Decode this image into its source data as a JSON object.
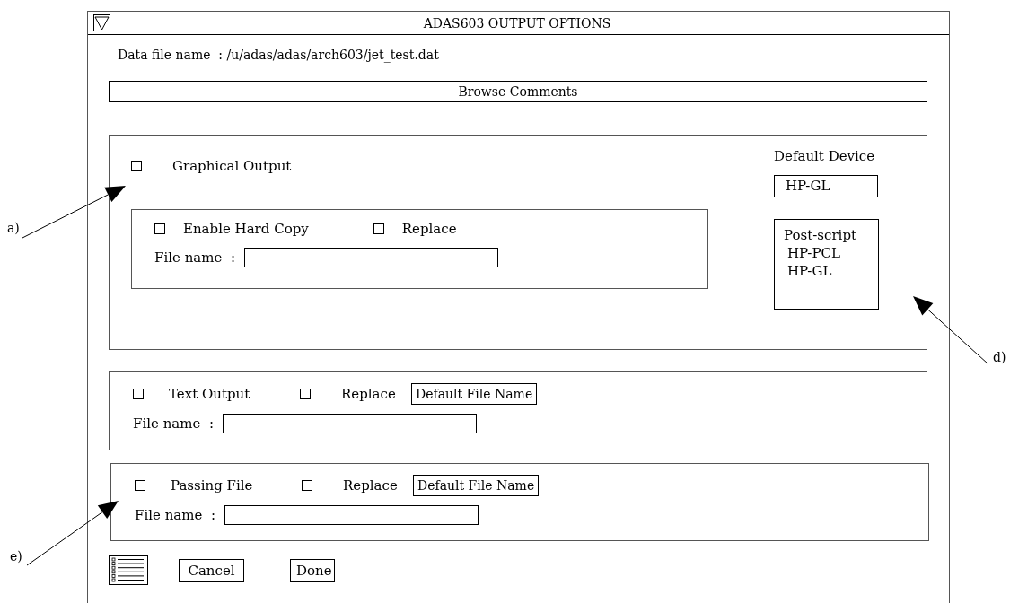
{
  "window": {
    "title": "ADAS603 OUTPUT OPTIONS"
  },
  "data_file": {
    "label": "Data file name  :",
    "value": "/u/adas/adas/arch603/jet_test.dat"
  },
  "browse_button": "Browse Comments",
  "graphical_output": {
    "label": "Graphical Output",
    "checked": false,
    "hard_copy": {
      "label": "Enable Hard Copy",
      "checked": false
    },
    "replace": {
      "label": "Replace",
      "checked": false
    },
    "file_name_label": "File name  :",
    "default_device_label": "Default Device",
    "default_device": "HP-GL",
    "devices": [
      {
        "label": "Post-script"
      },
      {
        "label": "HP-PCL"
      },
      {
        "label": "HP-GL"
      }
    ]
  },
  "text_output": {
    "label": "Text Output",
    "checked": false,
    "replace": {
      "label": "Replace",
      "checked": false
    },
    "default_button": "Default File Name",
    "file_name_label": "File name  :"
  },
  "passing_file": {
    "label": "Passing File",
    "checked": false,
    "replace": {
      "label": "Replace",
      "checked": false
    },
    "default_button": "Default File Name",
    "file_name_label": "File name  :"
  },
  "buttons": [
    "Cancel",
    "Done"
  ],
  "annotations": [
    {
      "label": "a)"
    },
    {
      "label": "d)"
    },
    {
      "label": "e)"
    }
  ]
}
